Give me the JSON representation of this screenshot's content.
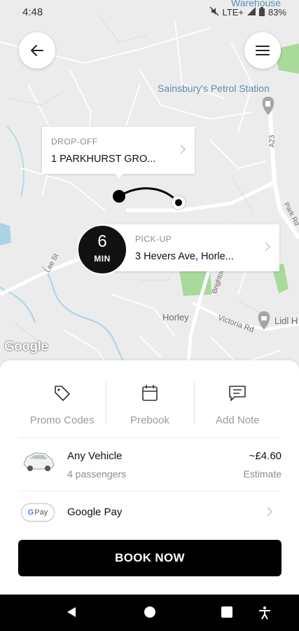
{
  "status_bar": {
    "time": "4:48",
    "network": "LTE+",
    "battery": "83%"
  },
  "map": {
    "labels": {
      "warehouse": "Warehouse",
      "petrol_station": "Sainsbury's Petrol Station",
      "horley": "Horley",
      "victoria_rd": "Victoria Rd",
      "lidl": "Lidl H",
      "road_a23": "A23",
      "road_left": "Lee St",
      "road_right": "Brighton Rd",
      "road_park": "Park Rd"
    },
    "attribution": "Google"
  },
  "dropoff": {
    "label": "DROP-OFF",
    "address": "1 PARKHURST GRO..."
  },
  "pickup": {
    "label": "PICK-UP",
    "address": "3 Hevers Ave, Horle..."
  },
  "eta": {
    "value": "6",
    "unit": "MIN"
  },
  "actions": [
    {
      "label": "Promo Codes",
      "icon": "tag-icon"
    },
    {
      "label": "Prebook",
      "icon": "calendar-icon"
    },
    {
      "label": "Add Note",
      "icon": "message-icon"
    }
  ],
  "vehicle": {
    "name": "Any Vehicle",
    "capacity": "4 passengers",
    "price": "~£4.60",
    "price_note": "Estimate"
  },
  "payment": {
    "badge": "Pay",
    "badge_g": "G",
    "method": "Google Pay"
  },
  "book_button": "BOOK NOW",
  "colors": {
    "map_water": "#aad3e8",
    "map_park": "#a9d99b",
    "map_road": "#ffffff",
    "button_dark": "#000000"
  }
}
